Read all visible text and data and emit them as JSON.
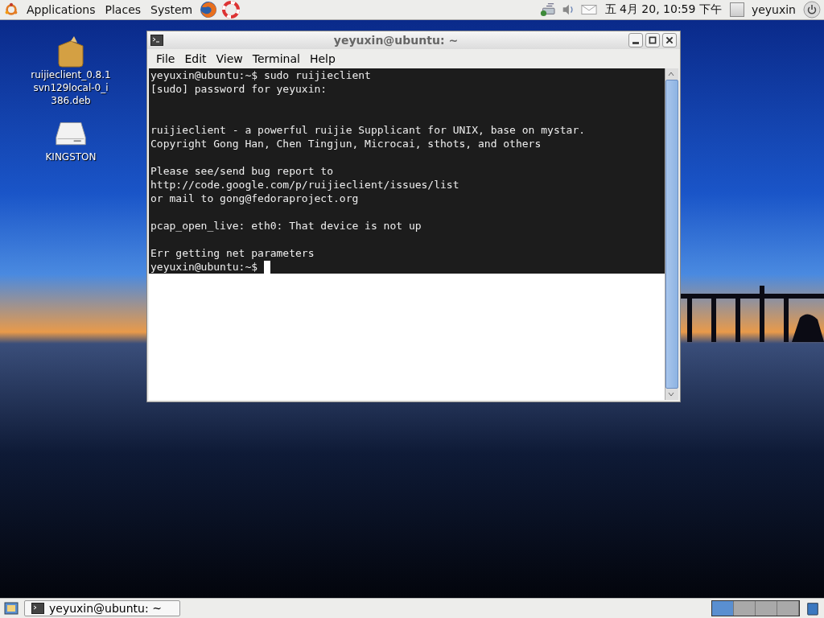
{
  "top_panel": {
    "menus": [
      "Applications",
      "Places",
      "System"
    ],
    "clock": "五 4月 20, 10:59 下午",
    "user": "yeyuxin"
  },
  "desktop_icons": [
    {
      "kind": "package",
      "label": "ruijieclient_0.8.1svn129local-0_i386.deb"
    },
    {
      "kind": "drive",
      "label": "KINGSTON"
    }
  ],
  "window": {
    "title": "yeyuxin@ubuntu: ~",
    "menu": [
      "File",
      "Edit",
      "View",
      "Terminal",
      "Help"
    ],
    "lines": [
      {
        "kind": "text",
        "text": "yeyuxin@ubuntu:~$ sudo ruijieclient"
      },
      {
        "kind": "text",
        "text": "[sudo] password for yeyuxin:"
      },
      {
        "kind": "blank"
      },
      {
        "kind": "blank"
      },
      {
        "kind": "text",
        "text": "ruijieclient - a powerful ruijie Supplicant for UNIX, base on mystar."
      },
      {
        "kind": "text",
        "text": "Copyright Gong Han, Chen Tingjun, Microcai, sthots, and others"
      },
      {
        "kind": "blank"
      },
      {
        "kind": "text",
        "text": "Please see/send bug report to"
      },
      {
        "kind": "text",
        "text": "http://code.google.com/p/ruijieclient/issues/list"
      },
      {
        "kind": "text",
        "text": "or mail to gong@fedoraproject.org"
      },
      {
        "kind": "blank"
      },
      {
        "kind": "text",
        "text": "pcap_open_live: eth0: That device is not up"
      },
      {
        "kind": "blank"
      },
      {
        "kind": "text",
        "text": "Err getting net parameters"
      },
      {
        "kind": "prompt",
        "text": "yeyuxin@ubuntu:~$"
      }
    ]
  },
  "taskbar": {
    "task": "yeyuxin@ubuntu: ~",
    "workspaces": [
      {
        "selected": true
      },
      {
        "selected": false
      },
      {
        "selected": false
      },
      {
        "selected": false
      }
    ]
  }
}
